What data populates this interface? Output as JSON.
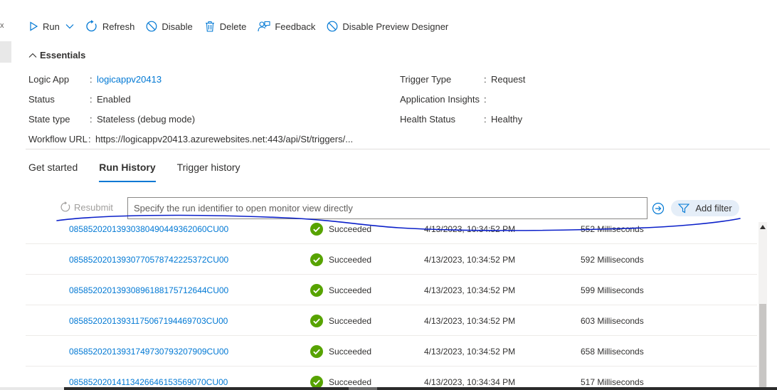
{
  "left_panel": {
    "close_glyph": "x"
  },
  "toolbar": {
    "run_label": "Run",
    "refresh_label": "Refresh",
    "disable_label": "Disable",
    "delete_label": "Delete",
    "feedback_label": "Feedback",
    "disable_preview_label": "Disable Preview Designer"
  },
  "essentials": {
    "toggle_label": "Essentials",
    "left": [
      {
        "label": "Logic App",
        "colon": ":",
        "value": "logicappv20413",
        "is_link": true
      },
      {
        "label": "Status",
        "colon": ":",
        "value": "Enabled"
      },
      {
        "label": "State type",
        "colon": ":",
        "value": "Stateless (debug mode)"
      },
      {
        "label": "Workflow URL",
        "colon": ":",
        "value": "https://logicappv20413.azurewebsites.net:443/api/St/triggers/..."
      }
    ],
    "right": [
      {
        "label": "Trigger Type",
        "colon": ":",
        "value": "Request"
      },
      {
        "label": "Application Insights",
        "colon": ":",
        "value": ""
      },
      {
        "label": "Health Status",
        "colon": ":",
        "value": "Healthy"
      }
    ]
  },
  "tabs": [
    {
      "label": "Get started",
      "active": false
    },
    {
      "label": "Run History",
      "active": true
    },
    {
      "label": "Trigger history",
      "active": false
    }
  ],
  "filter_bar": {
    "resubmit_label": "Resubmit",
    "search_placeholder": "Specify the run identifier to open monitor view directly",
    "add_filter_label": "Add filter"
  },
  "runs": [
    {
      "id": "08585202013930380490449362060CU00",
      "status": "Succeeded",
      "start_time": "4/13/2023, 10:34:52 PM",
      "duration": "552 Milliseconds"
    },
    {
      "id": "08585202013930770578742225372CU00",
      "status": "Succeeded",
      "start_time": "4/13/2023, 10:34:52 PM",
      "duration": "592 Milliseconds"
    },
    {
      "id": "08585202013930896188175712644CU00",
      "status": "Succeeded",
      "start_time": "4/13/2023, 10:34:52 PM",
      "duration": "599 Milliseconds"
    },
    {
      "id": "08585202013931175067194469703CU00",
      "status": "Succeeded",
      "start_time": "4/13/2023, 10:34:52 PM",
      "duration": "603 Milliseconds"
    },
    {
      "id": "08585202013931749730793207909CU00",
      "status": "Succeeded",
      "start_time": "4/13/2023, 10:34:52 PM",
      "duration": "658 Milliseconds"
    },
    {
      "id": "08585202014113426646153569070CU00",
      "status": "Succeeded",
      "start_time": "4/13/2023, 10:34:34 PM",
      "duration": "517 Milliseconds"
    }
  ],
  "colors": {
    "link": "#0078d4",
    "success": "#57a300",
    "annotation": "#0a1fc9",
    "add_filter_bg": "#e5eef8"
  }
}
